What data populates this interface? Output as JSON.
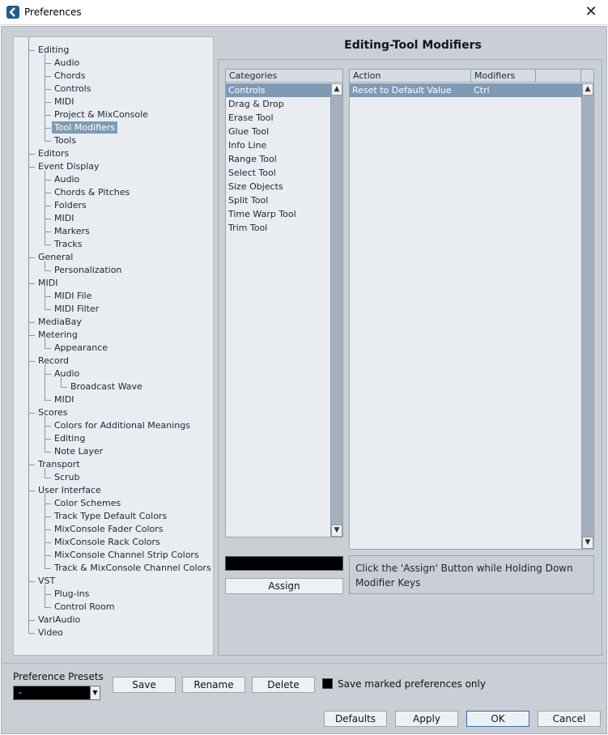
{
  "window": {
    "title": "Preferences"
  },
  "header": {
    "title": "Editing-Tool Modifiers"
  },
  "tree": {
    "items": [
      {
        "label": "Editing",
        "level": 0
      },
      {
        "label": "Audio",
        "level": 1
      },
      {
        "label": "Chords",
        "level": 1
      },
      {
        "label": "Controls",
        "level": 1
      },
      {
        "label": "MIDI",
        "level": 1
      },
      {
        "label": "Project & MixConsole",
        "level": 1
      },
      {
        "label": "Tool Modifiers",
        "level": 1,
        "selected": true
      },
      {
        "label": "Tools",
        "level": 1
      },
      {
        "label": "Editors",
        "level": 0
      },
      {
        "label": "Event Display",
        "level": 0
      },
      {
        "label": "Audio",
        "level": 1
      },
      {
        "label": "Chords & Pitches",
        "level": 1
      },
      {
        "label": "Folders",
        "level": 1
      },
      {
        "label": "MIDI",
        "level": 1
      },
      {
        "label": "Markers",
        "level": 1
      },
      {
        "label": "Tracks",
        "level": 1
      },
      {
        "label": "General",
        "level": 0
      },
      {
        "label": "Personalization",
        "level": 1
      },
      {
        "label": "MIDI",
        "level": 0
      },
      {
        "label": "MIDI File",
        "level": 1
      },
      {
        "label": "MIDI Filter",
        "level": 1
      },
      {
        "label": "MediaBay",
        "level": 0
      },
      {
        "label": "Metering",
        "level": 0
      },
      {
        "label": "Appearance",
        "level": 1
      },
      {
        "label": "Record",
        "level": 0
      },
      {
        "label": "Audio",
        "level": 1
      },
      {
        "label": "Broadcast Wave",
        "level": 2
      },
      {
        "label": "MIDI",
        "level": 1
      },
      {
        "label": "Scores",
        "level": 0
      },
      {
        "label": "Colors for Additional Meanings",
        "level": 1
      },
      {
        "label": "Editing",
        "level": 1
      },
      {
        "label": "Note Layer",
        "level": 1
      },
      {
        "label": "Transport",
        "level": 0
      },
      {
        "label": "Scrub",
        "level": 1
      },
      {
        "label": "User Interface",
        "level": 0
      },
      {
        "label": "Color Schemes",
        "level": 1
      },
      {
        "label": "Track Type Default Colors",
        "level": 1
      },
      {
        "label": "MixConsole Fader Colors",
        "level": 1
      },
      {
        "label": "MixConsole Rack Colors",
        "level": 1
      },
      {
        "label": "MixConsole Channel Strip Colors",
        "level": 1
      },
      {
        "label": "Track & MixConsole Channel Colors",
        "level": 1
      },
      {
        "label": "VST",
        "level": 0
      },
      {
        "label": "Plug-ins",
        "level": 1
      },
      {
        "label": "Control Room",
        "level": 1
      },
      {
        "label": "VariAudio",
        "level": 0
      },
      {
        "label": "Video",
        "level": 0
      }
    ]
  },
  "categories": {
    "header": "Categories",
    "items": [
      "Controls",
      "Drag & Drop",
      "Erase Tool",
      "Glue Tool",
      "Info Line",
      "Range Tool",
      "Select Tool",
      "Size Objects",
      "Split Tool",
      "Time Warp Tool",
      "Trim Tool"
    ],
    "selected_index": 0
  },
  "actions": {
    "headers": [
      "Action",
      "Modifiers"
    ],
    "rows": [
      {
        "action": "Reset to Default Value",
        "modifier": "Ctrl"
      }
    ]
  },
  "assign": {
    "button_label": "Assign",
    "hint": "Click the 'Assign' Button while Holding Down Modifier Keys"
  },
  "presets": {
    "label": "Preference Presets",
    "selected": "-",
    "save": "Save",
    "rename": "Rename",
    "delete": "Delete",
    "marked_only_label": "Save marked preferences only"
  },
  "footer": {
    "defaults": "Defaults",
    "apply": "Apply",
    "ok": "OK",
    "cancel": "Cancel"
  },
  "colors": {
    "selection": "#7f9ab4",
    "panel": "#e9edf1",
    "background": "#c9cfd5",
    "accent": "#1e5e8e"
  }
}
